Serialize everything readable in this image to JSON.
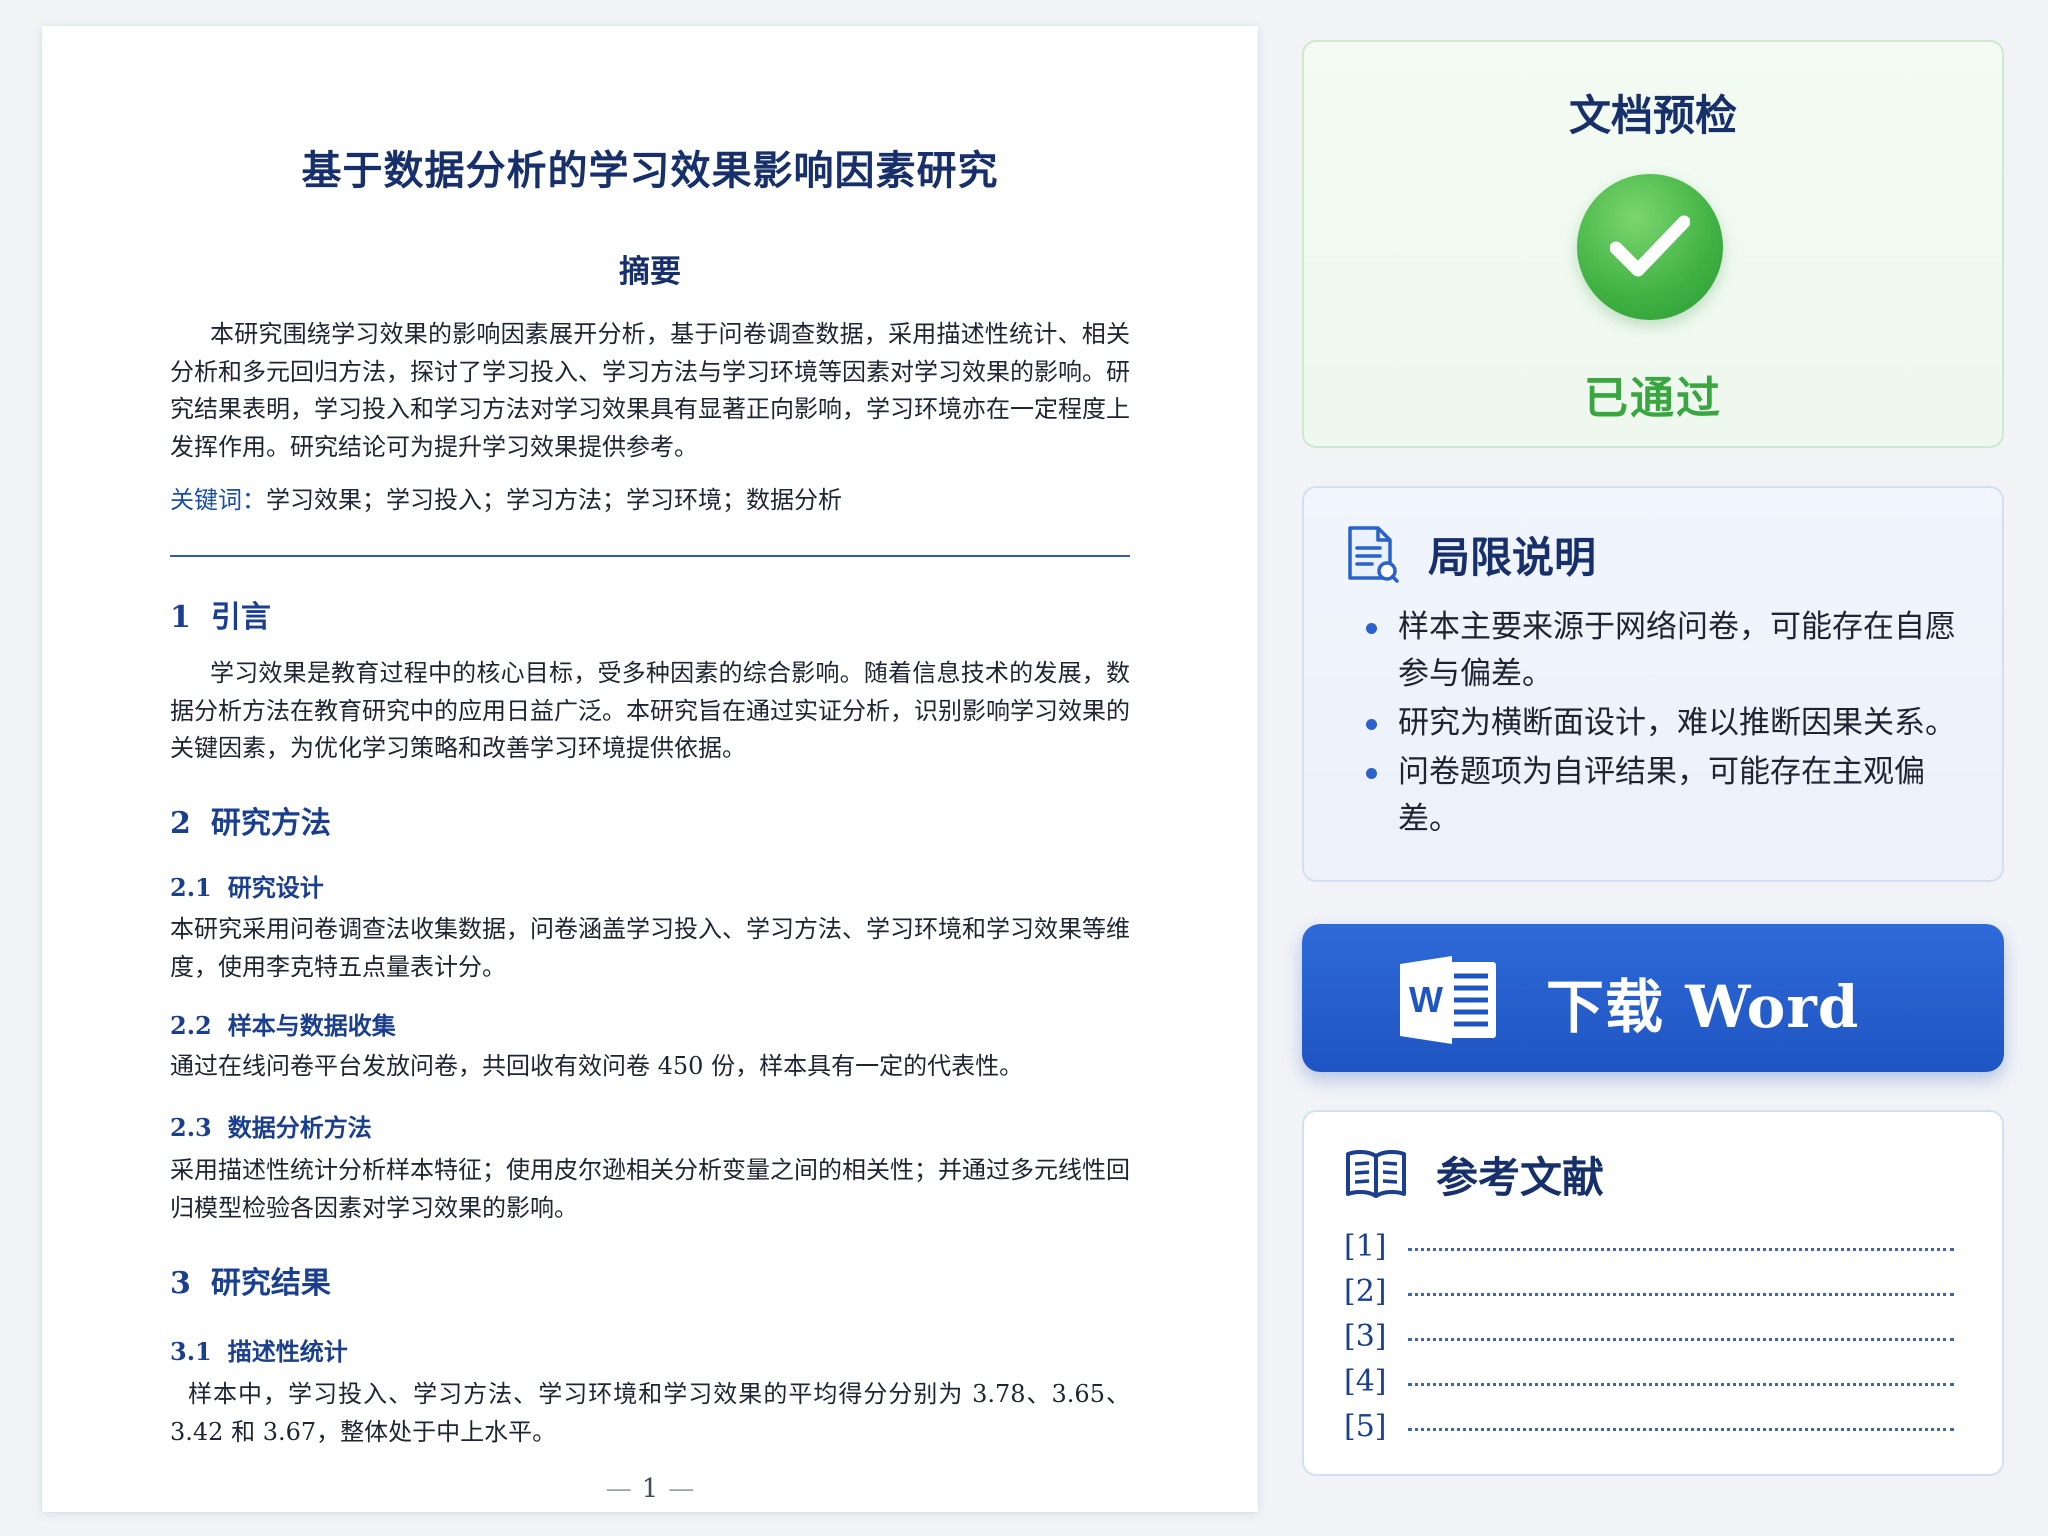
{
  "document": {
    "title": "基于数据分析的学习效果影响因素研究",
    "abstract_title": "摘要",
    "abstract_text": "本研究围绕学习效果的影响因素展开分析，基于问卷调查数据，采用描述性统计、相关分析和多元回归方法，探讨了学习投入、学习方法与学习环境等因素对学习效果的影响。研究结果表明，学习投入和学习方法对学习效果具有显著正向影响，学习环境亦在一定程度上发挥作用。研究结论可为提升学习效果提供参考。",
    "keywords_label": "关键词：",
    "keywords": "学习效果；学习投入；学习方法；学习环境；数据分析",
    "sections": {
      "s1": {
        "num": "1",
        "title": "引言",
        "text": "学习效果是教育过程中的核心目标，受多种因素的综合影响。随着信息技术的发展，数据分析方法在教育研究中的应用日益广泛。本研究旨在通过实证分析，识别影响学习效果的关键因素，为优化学习策略和改善学习环境提供依据。"
      },
      "s2": {
        "num": "2",
        "title": "研究方法"
      },
      "s2_1": {
        "num": "2.1",
        "title": "研究设计",
        "text": "本研究采用问卷调查法收集数据，问卷涵盖学习投入、学习方法、学习环境和学习效果等维度，使用李克特五点量表计分。"
      },
      "s2_2": {
        "num": "2.2",
        "title": "样本与数据收集",
        "text": "通过在线问卷平台发放问卷，共回收有效问卷 450 份，样本具有一定的代表性。"
      },
      "s2_3": {
        "num": "2.3",
        "title": "数据分析方法",
        "text": "采用描述性统计分析样本特征；使用皮尔逊相关分析变量之间的相关性；并通过多元线性回归模型检验各因素对学习效果的影响。"
      },
      "s3": {
        "num": "3",
        "title": "研究结果"
      },
      "s3_1": {
        "num": "3.1",
        "title": "描述性统计",
        "text": "样本中，学习投入、学习方法、学习环境和学习效果的平均得分分别为 3.78、3.65、3.42 和 3.67，整体处于中上水平。"
      }
    },
    "page_number": "1"
  },
  "precheck": {
    "title": "文档预检",
    "status": "已通过",
    "status_color": "#3aa63f"
  },
  "limitations": {
    "title": "局限说明",
    "items": [
      "样本主要来源于网络问卷，可能存在自愿参与偏差。",
      "研究为横断面设计，难以推断因果关系。",
      "问卷题项为自评结果，可能存在主观偏差。"
    ]
  },
  "download": {
    "label": "下载 Word",
    "icon": "word-icon",
    "color": "#2462cc"
  },
  "references": {
    "title": "参考文献",
    "items": [
      "[1]",
      "[2]",
      "[3]",
      "[4]",
      "[5]"
    ]
  }
}
